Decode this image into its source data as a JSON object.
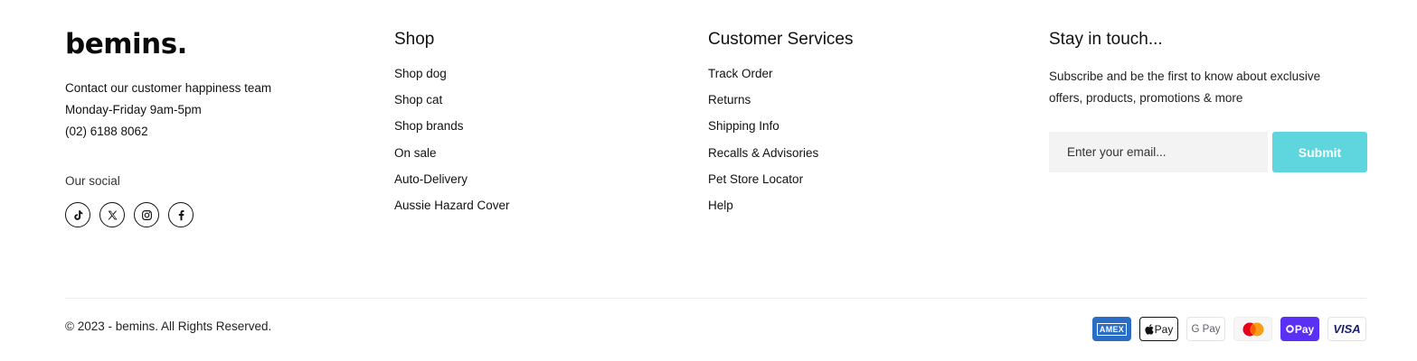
{
  "brand": {
    "logo": "bemins.",
    "contact": {
      "line1": "Contact our customer happiness team",
      "hours": "Monday-Friday 9am-5pm",
      "phone": "(02) 6188 8062"
    },
    "social_label": "Our social",
    "social_icons": [
      "tiktok-icon",
      "x-twitter-icon",
      "instagram-icon",
      "facebook-icon"
    ]
  },
  "shop": {
    "title": "Shop",
    "links": [
      "Shop dog",
      "Shop cat",
      "Shop brands",
      "On sale",
      "Auto-Delivery",
      "Aussie Hazard Cover"
    ]
  },
  "services": {
    "title": "Customer Services",
    "links": [
      "Track Order",
      "Returns",
      "Shipping Info",
      "Recalls & Advisories",
      "Pet Store Locator",
      "Help"
    ]
  },
  "newsletter": {
    "title": "Stay in touch...",
    "text": "Subscribe and be the first to know about exclusive offers, products, promotions & more",
    "placeholder": "Enter your email...",
    "submit_label": "Submit",
    "submit_color": "#5fd6dd"
  },
  "bottom": {
    "copyright": "© 2023 - bemins. All Rights Reserved.",
    "payments": {
      "amex": "AMEX",
      "apple": "Pay",
      "google": "G Pay",
      "shop": "Pay",
      "visa": "VISA"
    }
  }
}
